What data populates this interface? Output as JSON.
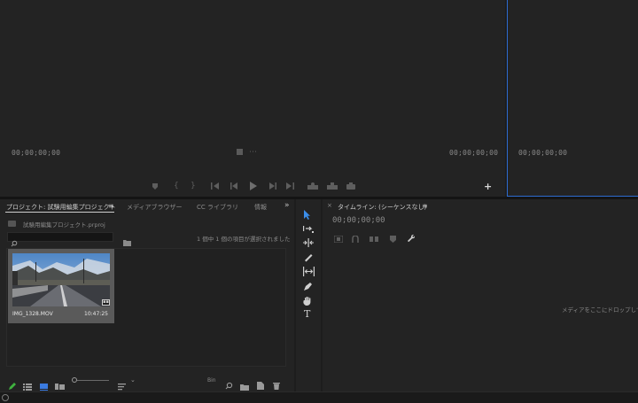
{
  "source_monitor": {
    "timecode_left": "00;00;00;00",
    "timecode_right": "00;00;00;00",
    "add_glyph": "+"
  },
  "program_monitor": {
    "timecode": "00;00;00;00"
  },
  "project_panel": {
    "tabs": [
      {
        "label": "プロジェクト: 試験用編集プロジェクト",
        "active": true
      },
      {
        "label": "メディアブラウザー",
        "active": false
      },
      {
        "label": "CC ライブラリ",
        "active": false
      },
      {
        "label": "情報",
        "active": false
      }
    ],
    "menu_glyph": "≡",
    "overflow_glyph": "»",
    "project_file": "試験用編集プロジェクト.prproj",
    "selection_status": "1 個中 1 個の項目が選択されました",
    "clip": {
      "name": "IMG_1328.MOV",
      "duration": "10:47:25"
    },
    "bin_glyph": "Bin"
  },
  "timeline_panel": {
    "close_glyph": "×",
    "title": "タイムライン: (シーケンスなし)",
    "menu_glyph": "≡",
    "timecode": "00;00;00;00",
    "drop_hint": "メディアをここにドロップして"
  },
  "tools": [
    "selection-tool",
    "track-select-tool",
    "ripple-edit-tool",
    "razor-tool",
    "slip-tool",
    "pen-tool",
    "hand-tool",
    "type-tool"
  ],
  "tool_type_glyph": "T",
  "colors": {
    "panel": "#232323",
    "background": "#1d1d1d",
    "accent_blue": "#2d6bd0",
    "active_pencil": "#3fb23f",
    "active_list": "#3b7be0"
  }
}
